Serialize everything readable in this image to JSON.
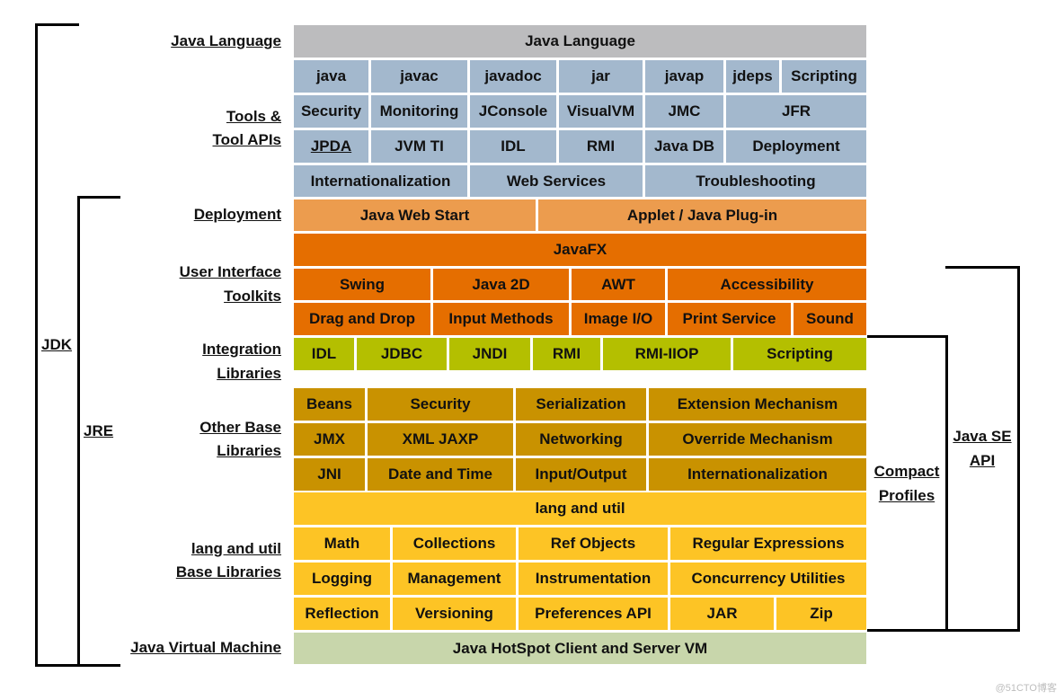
{
  "colors": {
    "language": "#bcbcbe",
    "tools": "#a3b8cd",
    "deployment": "#ec9c4e",
    "ui": "#e56e00",
    "integration": "#b4bf00",
    "other_base": "#c99200",
    "lang_util": "#fdc425",
    "jvm": "#c8d6ab"
  },
  "labels": {
    "java_language": "Java Language",
    "tools_line1": "Tools &",
    "tools_line2": "Tool APIs",
    "deployment": "Deployment",
    "ui_line1": "User Interface",
    "ui_line2": "Toolkits",
    "integration_line1": "Integration",
    "integration_line2": "Libraries",
    "other_line1": "Other Base",
    "other_line2": "Libraries",
    "langutil_line1": "lang and util",
    "langutil_line2": "Base Libraries",
    "jvm": "Java Virtual Machine"
  },
  "brackets": {
    "jdk": "JDK",
    "jre": "JRE",
    "compact_line1": "Compact",
    "compact_line2": "Profiles",
    "javase_line1": "Java SE",
    "javase_line2": "API"
  },
  "rows": [
    {
      "group": "language",
      "cells": [
        {
          "label": "Java Language"
        }
      ]
    },
    {
      "group": "tools",
      "cells": [
        {
          "label": "java"
        },
        {
          "label": "javac"
        },
        {
          "label": "javadoc"
        },
        {
          "label": "jar"
        },
        {
          "label": "javap"
        },
        {
          "label": "jdeps"
        },
        {
          "label": "Scripting"
        }
      ]
    },
    {
      "group": "tools",
      "cells": [
        {
          "label": "Security"
        },
        {
          "label": "Monitoring"
        },
        {
          "label": "JConsole"
        },
        {
          "label": "VisualVM"
        },
        {
          "label": "JMC"
        },
        {
          "label": "JFR"
        }
      ]
    },
    {
      "group": "tools",
      "cells": [
        {
          "label": "JPDA",
          "underline": true
        },
        {
          "label": "JVM TI"
        },
        {
          "label": "IDL"
        },
        {
          "label": "RMI"
        },
        {
          "label": "Java DB"
        },
        {
          "label": "Deployment"
        }
      ]
    },
    {
      "group": "tools",
      "cells": [
        {
          "label": "Internationalization"
        },
        {
          "label": "Web Services"
        },
        {
          "label": "Troubleshooting"
        }
      ]
    },
    {
      "group": "deployment",
      "cells": [
        {
          "label": "Java Web Start"
        },
        {
          "label": "Applet / Java Plug-in"
        }
      ]
    },
    {
      "group": "ui",
      "cells": [
        {
          "label": "JavaFX"
        }
      ]
    },
    {
      "group": "ui",
      "cells": [
        {
          "label": "Swing"
        },
        {
          "label": "Java 2D"
        },
        {
          "label": "AWT"
        },
        {
          "label": "Accessibility"
        }
      ]
    },
    {
      "group": "ui",
      "cells": [
        {
          "label": "Drag and Drop"
        },
        {
          "label": "Input Methods"
        },
        {
          "label": "Image I/O"
        },
        {
          "label": "Print Service"
        },
        {
          "label": "Sound"
        }
      ]
    },
    {
      "group": "integration",
      "cells": [
        {
          "label": "IDL"
        },
        {
          "label": "JDBC"
        },
        {
          "label": "JNDI"
        },
        {
          "label": "RMI"
        },
        {
          "label": "RMI-IIOP"
        },
        {
          "label": "Scripting"
        }
      ]
    },
    {
      "group": "other_base",
      "cells": [
        {
          "label": "Beans"
        },
        {
          "label": "Security"
        },
        {
          "label": "Serialization"
        },
        {
          "label": "Extension Mechanism"
        }
      ]
    },
    {
      "group": "other_base",
      "cells": [
        {
          "label": "JMX"
        },
        {
          "label": "XML JAXP"
        },
        {
          "label": "Networking"
        },
        {
          "label": "Override Mechanism"
        }
      ]
    },
    {
      "group": "other_base",
      "cells": [
        {
          "label": "JNI"
        },
        {
          "label": "Date and Time"
        },
        {
          "label": "Input/Output"
        },
        {
          "label": "Internationalization"
        }
      ]
    },
    {
      "group": "lang_util",
      "cells": [
        {
          "label": "lang and util"
        }
      ]
    },
    {
      "group": "lang_util",
      "cells": [
        {
          "label": "Math"
        },
        {
          "label": "Collections"
        },
        {
          "label": "Ref Objects"
        },
        {
          "label": "Regular Expressions"
        }
      ]
    },
    {
      "group": "lang_util",
      "cells": [
        {
          "label": "Logging"
        },
        {
          "label": "Management"
        },
        {
          "label": "Instrumentation"
        },
        {
          "label": "Concurrency Utilities"
        }
      ]
    },
    {
      "group": "lang_util",
      "cells": [
        {
          "label": "Reflection"
        },
        {
          "label": "Versioning"
        },
        {
          "label": "Preferences API"
        },
        {
          "label": "JAR"
        },
        {
          "label": "Zip"
        }
      ]
    },
    {
      "group": "jvm",
      "cells": [
        {
          "label": "Java HotSpot Client and Server VM"
        }
      ]
    }
  ],
  "watermark": "@51CTO博客"
}
